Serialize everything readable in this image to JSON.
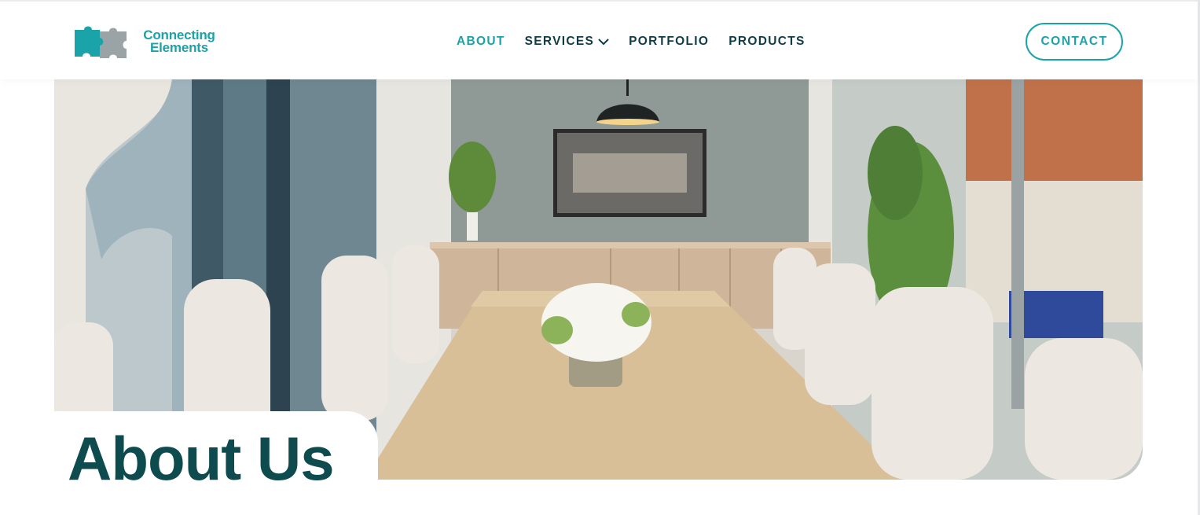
{
  "brand": {
    "line1": "Connecting",
    "line2": "Elements",
    "accent_color": "#1aa3a8",
    "dark_color": "#0f3d47"
  },
  "nav": {
    "items": [
      {
        "label": "ABOUT",
        "active": true
      },
      {
        "label": "SERVICES",
        "has_dropdown": true
      },
      {
        "label": "PORTFOLIO"
      },
      {
        "label": "PRODUCTS"
      }
    ],
    "contact_label": "CONTACT"
  },
  "hero": {
    "image": "conference-room-photo",
    "title": "About Us"
  }
}
